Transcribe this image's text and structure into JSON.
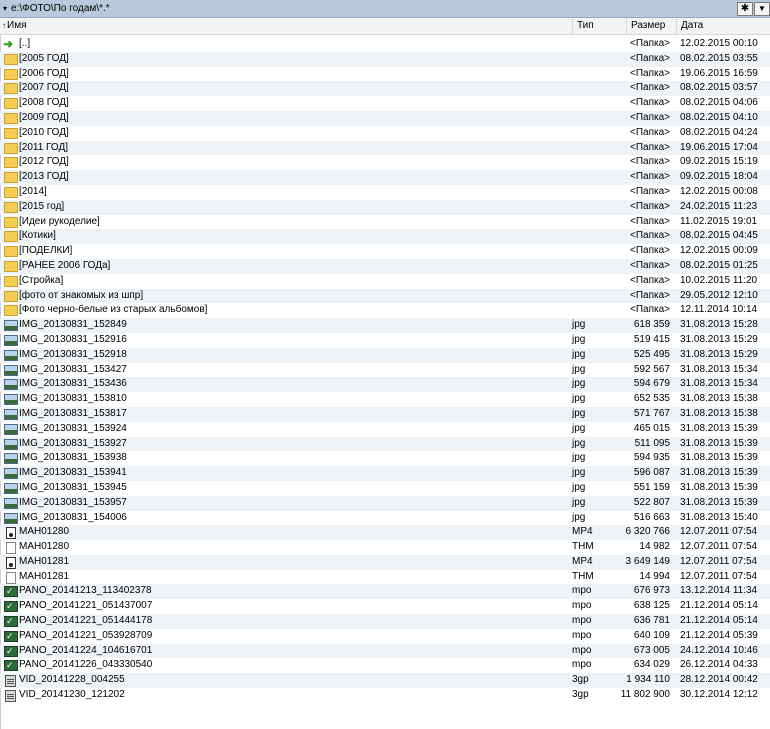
{
  "pathbar": {
    "path": "e:\\ФОТО\\По годам\\*.*",
    "star_label": "✱",
    "down_label": "▼",
    "drop_label": "▾"
  },
  "header": {
    "name": "Имя",
    "type": "Тип",
    "size": "Размер",
    "date": "Дата",
    "sort_arrow": "↑"
  },
  "rows": [
    {
      "icon": "up",
      "name": "[..]",
      "type": "",
      "size": "<Папка>",
      "date": "12.02.2015 00:10"
    },
    {
      "icon": "folder",
      "name": "[2005 ГОД]",
      "type": "",
      "size": "<Папка>",
      "date": "08.02.2015 03:55"
    },
    {
      "icon": "folder",
      "name": "[2006 ГОД]",
      "type": "",
      "size": "<Папка>",
      "date": "19.06.2015 16:59"
    },
    {
      "icon": "folder",
      "name": "[2007 ГОД]",
      "type": "",
      "size": "<Папка>",
      "date": "08.02.2015 03:57"
    },
    {
      "icon": "folder",
      "name": "[2008 ГОД]",
      "type": "",
      "size": "<Папка>",
      "date": "08.02.2015 04:06"
    },
    {
      "icon": "folder",
      "name": "[2009 ГОД]",
      "type": "",
      "size": "<Папка>",
      "date": "08.02.2015 04:10"
    },
    {
      "icon": "folder",
      "name": "[2010 ГОД]",
      "type": "",
      "size": "<Папка>",
      "date": "08.02.2015 04:24"
    },
    {
      "icon": "folder",
      "name": "[2011 ГОД]",
      "type": "",
      "size": "<Папка>",
      "date": "19.06.2015 17:04"
    },
    {
      "icon": "folder",
      "name": "[2012 ГОД]",
      "type": "",
      "size": "<Папка>",
      "date": "09.02.2015 15:19"
    },
    {
      "icon": "folder",
      "name": "[2013 ГОД]",
      "type": "",
      "size": "<Папка>",
      "date": "09.02.2015 18:04"
    },
    {
      "icon": "folder",
      "name": "[2014]",
      "type": "",
      "size": "<Папка>",
      "date": "12.02.2015 00:08"
    },
    {
      "icon": "folder",
      "name": "[2015 год]",
      "type": "",
      "size": "<Папка>",
      "date": "24.02.2015 11:23"
    },
    {
      "icon": "folder",
      "name": "[Идеи рукоделие]",
      "type": "",
      "size": "<Папка>",
      "date": "11.02.2015 19:01"
    },
    {
      "icon": "folder",
      "name": "[Котики]",
      "type": "",
      "size": "<Папка>",
      "date": "08.02.2015 04:45"
    },
    {
      "icon": "folder",
      "name": "[ПОДЕЛКИ]",
      "type": "",
      "size": "<Папка>",
      "date": "12.02.2015 00:09"
    },
    {
      "icon": "folder",
      "name": "[РАНЕЕ 2006 ГОДа]",
      "type": "",
      "size": "<Папка>",
      "date": "08.02.2015 01:25"
    },
    {
      "icon": "folder",
      "name": "[Стройка]",
      "type": "",
      "size": "<Папка>",
      "date": "10.02.2015 11:20"
    },
    {
      "icon": "folder",
      "name": "[фото от  знакомых из шпр]",
      "type": "",
      "size": "<Папка>",
      "date": "29.05.2012 12:10"
    },
    {
      "icon": "folder",
      "name": "[Фото черно-белые из старых альбомов]",
      "type": "",
      "size": "<Папка>",
      "date": "12.11.2014 10:14"
    },
    {
      "icon": "image",
      "name": "IMG_20130831_152849",
      "type": "jpg",
      "size": "618 359",
      "date": "31.08.2013 15:28"
    },
    {
      "icon": "image",
      "name": "IMG_20130831_152916",
      "type": "jpg",
      "size": "519 415",
      "date": "31.08.2013 15:29"
    },
    {
      "icon": "image",
      "name": "IMG_20130831_152918",
      "type": "jpg",
      "size": "525 495",
      "date": "31.08.2013 15:29"
    },
    {
      "icon": "image",
      "name": "IMG_20130831_153427",
      "type": "jpg",
      "size": "592 567",
      "date": "31.08.2013 15:34"
    },
    {
      "icon": "image",
      "name": "IMG_20130831_153436",
      "type": "jpg",
      "size": "594 679",
      "date": "31.08.2013 15:34"
    },
    {
      "icon": "image",
      "name": "IMG_20130831_153810",
      "type": "jpg",
      "size": "652 535",
      "date": "31.08.2013 15:38"
    },
    {
      "icon": "image",
      "name": "IMG_20130831_153817",
      "type": "jpg",
      "size": "571 767",
      "date": "31.08.2013 15:38"
    },
    {
      "icon": "image",
      "name": "IMG_20130831_153924",
      "type": "jpg",
      "size": "465 015",
      "date": "31.08.2013 15:39"
    },
    {
      "icon": "image",
      "name": "IMG_20130831_153927",
      "type": "jpg",
      "size": "511 095",
      "date": "31.08.2013 15:39"
    },
    {
      "icon": "image",
      "name": "IMG_20130831_153938",
      "type": "jpg",
      "size": "594 935",
      "date": "31.08.2013 15:39"
    },
    {
      "icon": "image",
      "name": "IMG_20130831_153941",
      "type": "jpg",
      "size": "596 087",
      "date": "31.08.2013 15:39"
    },
    {
      "icon": "image",
      "name": "IMG_20130831_153945",
      "type": "jpg",
      "size": "551 159",
      "date": "31.08.2013 15:39"
    },
    {
      "icon": "image",
      "name": "IMG_20130831_153957",
      "type": "jpg",
      "size": "522 807",
      "date": "31.08.2013 15:39"
    },
    {
      "icon": "image",
      "name": "IMG_20130831_154006",
      "type": "jpg",
      "size": "516 663",
      "date": "31.08.2013 15:40"
    },
    {
      "icon": "video",
      "name": "MAH01280",
      "type": "MP4",
      "size": "6 320 766",
      "date": "12.07.2011 07:54"
    },
    {
      "icon": "thm",
      "name": "MAH01280",
      "type": "THM",
      "size": "14 982",
      "date": "12.07.2011 07:54"
    },
    {
      "icon": "video",
      "name": "MAH01281",
      "type": "MP4",
      "size": "3 649 149",
      "date": "12.07.2011 07:54"
    },
    {
      "icon": "thm",
      "name": "MAH01281",
      "type": "THM",
      "size": "14 994",
      "date": "12.07.2011 07:54"
    },
    {
      "icon": "mpo",
      "name": "PANO_20141213_113402378",
      "type": "mpo",
      "size": "676 973",
      "date": "13.12.2014 11:34"
    },
    {
      "icon": "mpo",
      "name": "PANO_20141221_051437007",
      "type": "mpo",
      "size": "638 125",
      "date": "21.12.2014 05:14"
    },
    {
      "icon": "mpo",
      "name": "PANO_20141221_051444178",
      "type": "mpo",
      "size": "636 781",
      "date": "21.12.2014 05:14"
    },
    {
      "icon": "mpo",
      "name": "PANO_20141221_053928709",
      "type": "mpo",
      "size": "640 109",
      "date": "21.12.2014 05:39"
    },
    {
      "icon": "mpo",
      "name": "PANO_20141224_104616701",
      "type": "mpo",
      "size": "673 005",
      "date": "24.12.2014 10:46"
    },
    {
      "icon": "mpo",
      "name": "PANO_20141226_043330540",
      "type": "mpo",
      "size": "634 029",
      "date": "26.12.2014 04:33"
    },
    {
      "icon": "3gp",
      "name": "VID_20141228_004255",
      "type": "3gp",
      "size": "1 934 110",
      "date": "28.12.2014 00:42"
    },
    {
      "icon": "3gp",
      "name": "VID_20141230_121202",
      "type": "3gp",
      "size": "11 802 900",
      "date": "30.12.2014 12:12"
    }
  ]
}
